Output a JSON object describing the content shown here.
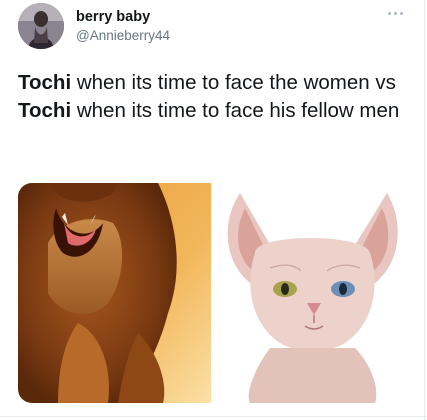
{
  "tweet": {
    "display_name": "berry baby",
    "handle": "@Annieberry44",
    "text_parts": [
      "Tochi",
      " when its time to face the women vs ",
      "Tochi",
      " when its time to face his fellow men"
    ],
    "media": [
      {
        "name": "roaring-lion-image"
      },
      {
        "name": "sphynx-cat-image"
      }
    ]
  },
  "colors": {
    "text": "#14171a",
    "secondary": "#657786",
    "divider": "#e6ecf0"
  },
  "icons": [
    "more-options-icon"
  ]
}
